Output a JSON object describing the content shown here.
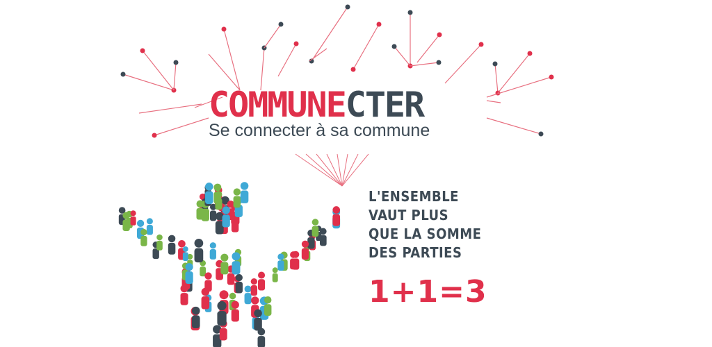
{
  "brand": {
    "part1": "COMMUNE",
    "part2": "CTER",
    "tagline": "Se connecter à sa commune"
  },
  "slogan": {
    "lines": [
      "L'ENSEMBLE",
      "VAUT PLUS",
      "QUE LA SOMME",
      "DES PARTIES"
    ],
    "equation": "1+1=3"
  },
  "colors": {
    "red": "#e0304b",
    "dark": "#3d4a55",
    "green": "#7ab648",
    "blue": "#3fa9d6",
    "line_red": "#e87080"
  }
}
